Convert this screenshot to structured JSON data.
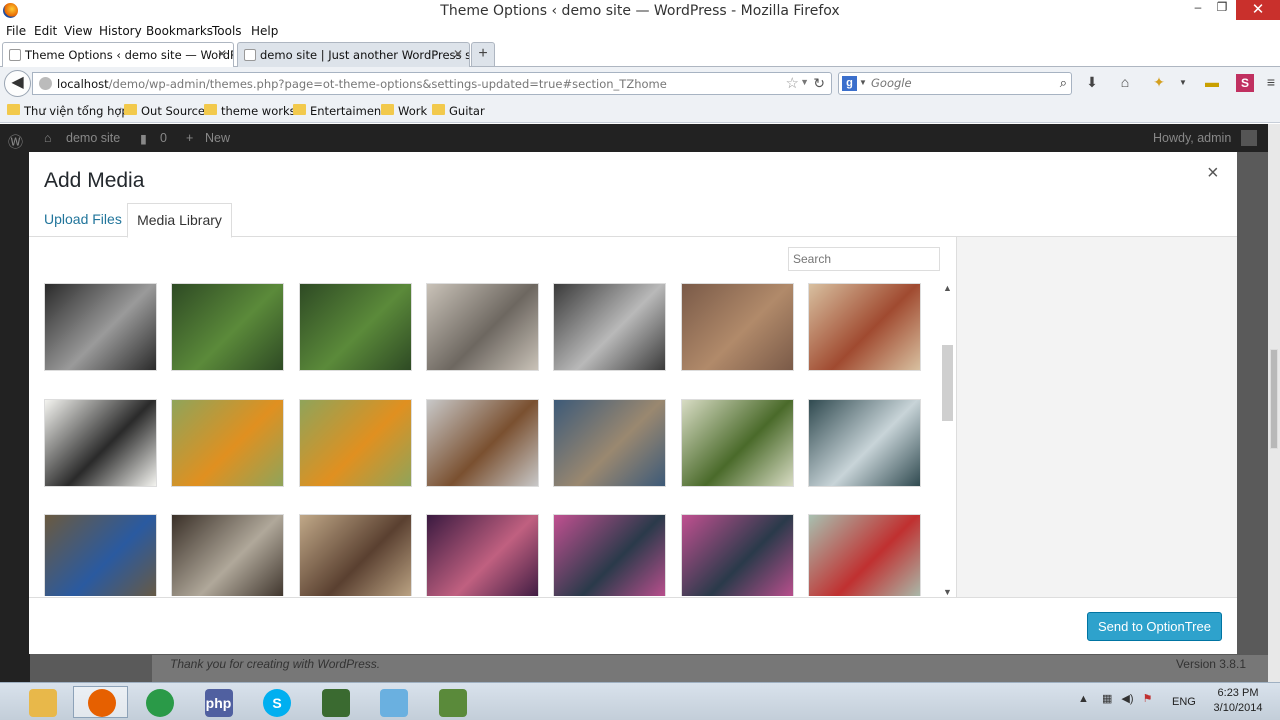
{
  "window": {
    "title": "Theme Options ‹ demo site — WordPress - Mozilla Firefox",
    "minimize": "–",
    "maximize": "❐",
    "close": "✕"
  },
  "menu": [
    "File",
    "Edit",
    "View",
    "History",
    "Bookmarks",
    "Tools",
    "Help"
  ],
  "tabs": [
    {
      "label": "Theme Options ‹ demo site — WordP...",
      "close": "✕"
    },
    {
      "label": "demo site | Just another WordPress site",
      "close": "✕"
    }
  ],
  "new_tab": "+",
  "url": {
    "host": "localhost",
    "path": "/demo/wp-admin/themes.php?page=ot-theme-options&settings-updated=true#section_TZhome"
  },
  "search": {
    "placeholder": "Google",
    "engine": "g"
  },
  "bookmarks": [
    "Thư viện tổng hợp",
    "Out Source",
    "theme works",
    "Entertaiment",
    "Work",
    "Guitar"
  ],
  "wp": {
    "site": "demo site",
    "comments": "0",
    "new": "New",
    "howdy": "Howdy, admin",
    "footer_thanks": "Thank you for creating with WordPress.",
    "version": "Version 3.8.1"
  },
  "modal": {
    "title": "Add Media",
    "close": "×",
    "tab_upload": "Upload Files",
    "tab_library": "Media Library",
    "search_placeholder": "Search",
    "send_button": "Send to OptionTree"
  },
  "media": [
    {
      "name": "band-bw",
      "colors": [
        "#2a2a2a",
        "#9a9a9a"
      ]
    },
    {
      "name": "camera-tripod-1",
      "colors": [
        "#2e4a24",
        "#5b8a3a"
      ]
    },
    {
      "name": "camera-tripod-2",
      "colors": [
        "#2e4a24",
        "#5b8a3a"
      ]
    },
    {
      "name": "dancer-wall",
      "colors": [
        "#c9c2b8",
        "#6d6760"
      ]
    },
    {
      "name": "woman-window-bw",
      "colors": [
        "#3a3a3a",
        "#b9b9b9"
      ]
    },
    {
      "name": "cat-closeup",
      "colors": [
        "#7a5a48",
        "#b18a6a"
      ]
    },
    {
      "name": "couple-beach",
      "colors": [
        "#d8c0a0",
        "#a04a30"
      ]
    },
    {
      "name": "woman-chair-paint",
      "colors": [
        "#f4f4f0",
        "#2a2a2a"
      ]
    },
    {
      "name": "kites-yellow-1",
      "colors": [
        "#8fa45a",
        "#e09020"
      ]
    },
    {
      "name": "kites-yellow-2",
      "colors": [
        "#8fa45a",
        "#e09020"
      ]
    },
    {
      "name": "woman-brown-coat",
      "colors": [
        "#c8c8c8",
        "#7a5030"
      ]
    },
    {
      "name": "feet-sandals",
      "colors": [
        "#3d5a78",
        "#9a8870"
      ]
    },
    {
      "name": "field-road",
      "colors": [
        "#d8dcc4",
        "#4a6a2a"
      ]
    },
    {
      "name": "pigeons",
      "colors": [
        "#304a50",
        "#c8d4d8"
      ]
    },
    {
      "name": "teapot-blue",
      "colors": [
        "#6a5a40",
        "#2a5aa0"
      ]
    },
    {
      "name": "photographer-street",
      "colors": [
        "#3a3028",
        "#b0a89a"
      ]
    },
    {
      "name": "girl-bench",
      "colors": [
        "#c0a888",
        "#5a4030"
      ]
    },
    {
      "name": "woman-portrait-purple",
      "colors": [
        "#3a1a40",
        "#c06080"
      ]
    },
    {
      "name": "woman-pink-shirt-1",
      "colors": [
        "#c05090",
        "#2a3a4a"
      ]
    },
    {
      "name": "woman-pink-shirt-2",
      "colors": [
        "#c05090",
        "#2a3a4a"
      ]
    },
    {
      "name": "wall-target",
      "colors": [
        "#a8c0b0",
        "#c03030"
      ]
    }
  ],
  "taskbar": {
    "apps": [
      {
        "name": "file-explorer",
        "color": "#e8b84a"
      },
      {
        "name": "firefox",
        "color": "#e66000"
      },
      {
        "name": "chrome",
        "color": "#2a9a48"
      },
      {
        "name": "php-designer",
        "color": "#5060a0",
        "label": "php"
      },
      {
        "name": "skype",
        "color": "#00aff0",
        "label": "S"
      },
      {
        "name": "app-green",
        "color": "#3a6a30"
      },
      {
        "name": "app-notepad",
        "color": "#6ab0e0"
      },
      {
        "name": "app-recorder",
        "color": "#5a8a3a"
      }
    ],
    "lang": "ENG",
    "time": "6:23 PM",
    "date": "3/10/2014"
  }
}
